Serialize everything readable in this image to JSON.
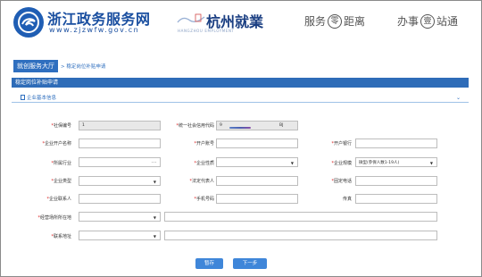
{
  "header": {
    "site_title": "浙江政务服务网",
    "site_url": "www.zjzwfw.gov.cn",
    "city_name": "杭州就業",
    "city_subtitle": "HANGZHOU EMPLOYMENT",
    "slogan_1": {
      "pre": "服务",
      "ring": "零",
      "post": "距离"
    },
    "slogan_2": {
      "pre": "办事",
      "ring": "壹",
      "post": "站通"
    }
  },
  "breadcrumb": {
    "home": "就创服务大厅",
    "current": "> 稳定岗位补贴申请"
  },
  "panel_title": "稳定岗位补贴申请",
  "section_title": "企业基本信息",
  "form": {
    "rows": [
      [
        {
          "label": "社保编号",
          "required": true,
          "value": "1",
          "readonly": true
        },
        {
          "label": "统一社会信用代码",
          "required": true,
          "value": "9",
          "value_suffix": "BJ",
          "readonly": true
        }
      ],
      [
        {
          "label": "企业开户名称",
          "required": true,
          "value": ""
        },
        {
          "label": "开户账号",
          "required": true,
          "value": ""
        },
        {
          "label": "开户银行",
          "required": true,
          "value": ""
        }
      ],
      [
        {
          "label": "所属行业",
          "required": true,
          "value": "",
          "control": "picker"
        },
        {
          "label": "企业性质",
          "required": true,
          "value": "",
          "control": "select"
        },
        {
          "label": "企业规模",
          "required": true,
          "value": "微型(参保人数1-19人)",
          "control": "select"
        }
      ],
      [
        {
          "label": "企业类型",
          "required": true,
          "value": "",
          "control": "select"
        },
        {
          "label": "法定代表人",
          "required": true,
          "value": ""
        },
        {
          "label": "固定电话",
          "required": true,
          "value": ""
        }
      ],
      [
        {
          "label": "企业联系人",
          "required": true,
          "value": ""
        },
        {
          "label": "手机号码",
          "required": true,
          "value": ""
        },
        {
          "label": "传真",
          "required": false,
          "value": ""
        }
      ],
      [
        {
          "label": "经营场所所在地",
          "required": true,
          "value": "",
          "control": "select",
          "wide": true
        }
      ],
      [
        {
          "label": "联系地址",
          "required": true,
          "value": "",
          "control": "select",
          "wide": true
        }
      ]
    ]
  },
  "buttons": {
    "save": "暂存",
    "next": "下一步"
  },
  "colors": {
    "brand_blue": "#2e6cb8",
    "button_blue": "#3f86d9",
    "required_red": "#d92020"
  }
}
